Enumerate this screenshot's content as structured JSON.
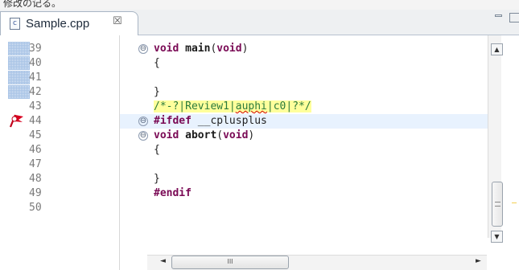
{
  "header": {
    "cut_text": "修改の记る。"
  },
  "tab": {
    "icon_letter": "c",
    "label": "Sample.cpp",
    "close_glyph": "☒"
  },
  "window": {
    "minimize_glyph": "",
    "maximize_glyph": ""
  },
  "editor": {
    "lines": [
      {
        "number": "39",
        "fold": true,
        "fold_glyph": "⊖",
        "code_html": "<span class=\"kw\">void</span> <span class=\"fn\">main</span>(<span class=\"kw\">void</span>)"
      },
      {
        "number": "40",
        "fold": false,
        "code_html": "{"
      },
      {
        "number": "41",
        "fold": false,
        "code_html": ""
      },
      {
        "number": "42",
        "fold": false,
        "code_html": "}"
      },
      {
        "number": "43",
        "fold": false,
        "code_html": "<span class=\"review\">/*-?|Review1|<span class=\"squig\">auphi</span>|c0|?*/</span>"
      },
      {
        "number": "44",
        "fold": true,
        "fold_glyph": "⊖",
        "code_html": "<span class=\"kw\">#ifdef</span> __cplusplus"
      },
      {
        "number": "45",
        "fold": true,
        "fold_glyph": "⊖",
        "code_html": "<span class=\"kw\">void</span> <span class=\"fn\">abort</span>(<span class=\"kw\">void</span>)"
      },
      {
        "number": "46",
        "fold": false,
        "code_html": "{"
      },
      {
        "number": "47",
        "fold": false,
        "code_html": ""
      },
      {
        "number": "48",
        "fold": false,
        "code_html": "}"
      },
      {
        "number": "49",
        "fold": false,
        "code_html": "<span class=\"kw\">#endif</span>"
      },
      {
        "number": "50",
        "fold": false,
        "code_html": ""
      }
    ],
    "highlighted_line": "43"
  },
  "scrollbars": {
    "up": "▲",
    "down": "▼",
    "grip": "≡",
    "left": "◄",
    "right": "►",
    "h_grip": "III"
  }
}
